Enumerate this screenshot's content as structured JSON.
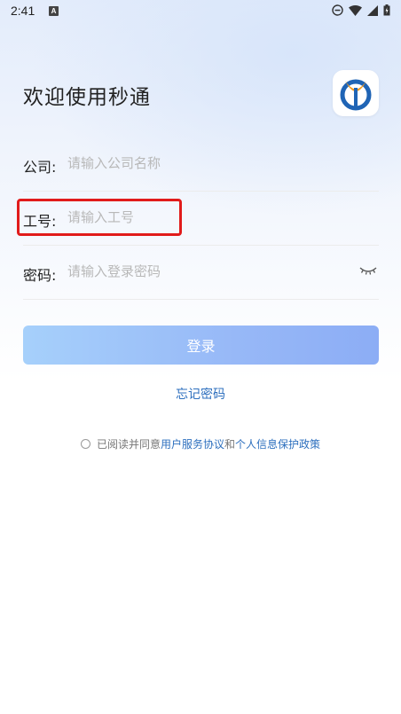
{
  "status_bar": {
    "time": "2:41",
    "notif_glyph": "A"
  },
  "header": {
    "welcome": "欢迎使用秒通"
  },
  "form": {
    "company": {
      "label": "公司:",
      "placeholder": "请输入公司名称"
    },
    "employee_id": {
      "label": "工号:",
      "placeholder": "请输入工号"
    },
    "password": {
      "label": "密码:",
      "placeholder": "请输入登录密码"
    }
  },
  "actions": {
    "login": "登录",
    "forgot": "忘记密码"
  },
  "agreement": {
    "prefix": "已阅读并同意",
    "user_agreement": "用户服务协议",
    "and": "和",
    "privacy_policy": "个人信息保护政策"
  },
  "colors": {
    "accent": "#2d6fbe",
    "highlight": "#e11b1b",
    "button_start": "#a6d0fb",
    "button_end": "#8cadf5"
  }
}
